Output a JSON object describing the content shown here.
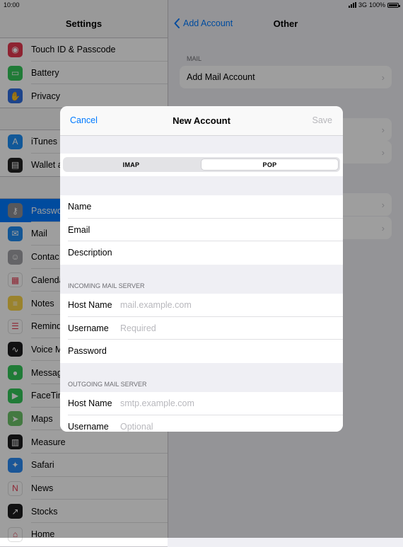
{
  "status": {
    "time": "10:00",
    "network": "3G",
    "battery": "100%"
  },
  "sidebar": {
    "title": "Settings",
    "groups": [
      [
        {
          "label": "Touch ID & Passcode",
          "icon": "fingerprint-icon",
          "color": "#e53950",
          "glyph": "◉"
        },
        {
          "label": "Battery",
          "icon": "battery-icon",
          "color": "#34c759",
          "glyph": "▭"
        },
        {
          "label": "Privacy",
          "icon": "hand-icon",
          "color": "#2f6fe0",
          "glyph": "✋"
        }
      ],
      [
        {
          "label": "iTunes",
          "icon": "app-store-icon",
          "color": "#1c8ef5",
          "glyph": "A"
        },
        {
          "label": "Wallet a",
          "icon": "wallet-icon",
          "color": "#222222",
          "glyph": "▤"
        }
      ],
      [
        {
          "label": "Passwo",
          "icon": "key-icon",
          "color": "#8e8e93",
          "glyph": "⚷",
          "selected": true
        },
        {
          "label": "Mail",
          "icon": "mail-icon",
          "color": "#1f8cf0",
          "glyph": "✉"
        },
        {
          "label": "Contac",
          "icon": "contacts-icon",
          "color": "#a2a2a6",
          "glyph": "☺"
        },
        {
          "label": "Calenda",
          "icon": "calendar-icon",
          "color": "#ffffff",
          "glyph": "▦",
          "dark": true
        },
        {
          "label": "Notes",
          "icon": "notes-icon",
          "color": "#f8d34a",
          "glyph": "≡"
        },
        {
          "label": "Remind",
          "icon": "reminders-icon",
          "color": "#ffffff",
          "glyph": "☰",
          "dark": true
        },
        {
          "label": "Voice M",
          "icon": "voice-memos-icon",
          "color": "#1c1c1e",
          "glyph": "∿"
        },
        {
          "label": "Messag",
          "icon": "messages-icon",
          "color": "#34c759",
          "glyph": "●"
        },
        {
          "label": "FaceTin",
          "icon": "facetime-icon",
          "color": "#34c759",
          "glyph": "▶"
        },
        {
          "label": "Maps",
          "icon": "maps-icon",
          "color": "#6cc46a",
          "glyph": "➤"
        },
        {
          "label": "Measure",
          "icon": "measure-icon",
          "color": "#1c1c1e",
          "glyph": "▥"
        },
        {
          "label": "Safari",
          "icon": "safari-icon",
          "color": "#2a8cf4",
          "glyph": "✦"
        },
        {
          "label": "News",
          "icon": "news-icon",
          "color": "#ffffff",
          "glyph": "N",
          "dark": true
        },
        {
          "label": "Stocks",
          "icon": "stocks-icon",
          "color": "#1c1c1e",
          "glyph": "↗"
        },
        {
          "label": "Home",
          "icon": "home-icon",
          "color": "#ffffff",
          "glyph": "⌂",
          "dark": true
        }
      ]
    ]
  },
  "detail": {
    "back_label": "Add Account",
    "title": "Other",
    "mail_header": "MAIL",
    "add_mail_label": "Add Mail Account"
  },
  "modal": {
    "cancel": "Cancel",
    "title": "New Account",
    "save": "Save",
    "segments": [
      "IMAP",
      "POP"
    ],
    "selected_segment": "POP",
    "fields": [
      "Name",
      "Email",
      "Description"
    ],
    "incoming_header": "INCOMING MAIL SERVER",
    "incoming": [
      {
        "label": "Host Name",
        "placeholder": "mail.example.com"
      },
      {
        "label": "Username",
        "placeholder": "Required"
      },
      {
        "label": "Password",
        "placeholder": ""
      }
    ],
    "outgoing_header": "OUTGOING MAIL SERVER",
    "outgoing": [
      {
        "label": "Host Name",
        "placeholder": "smtp.example.com"
      },
      {
        "label": "Username",
        "placeholder": "Optional"
      }
    ]
  }
}
